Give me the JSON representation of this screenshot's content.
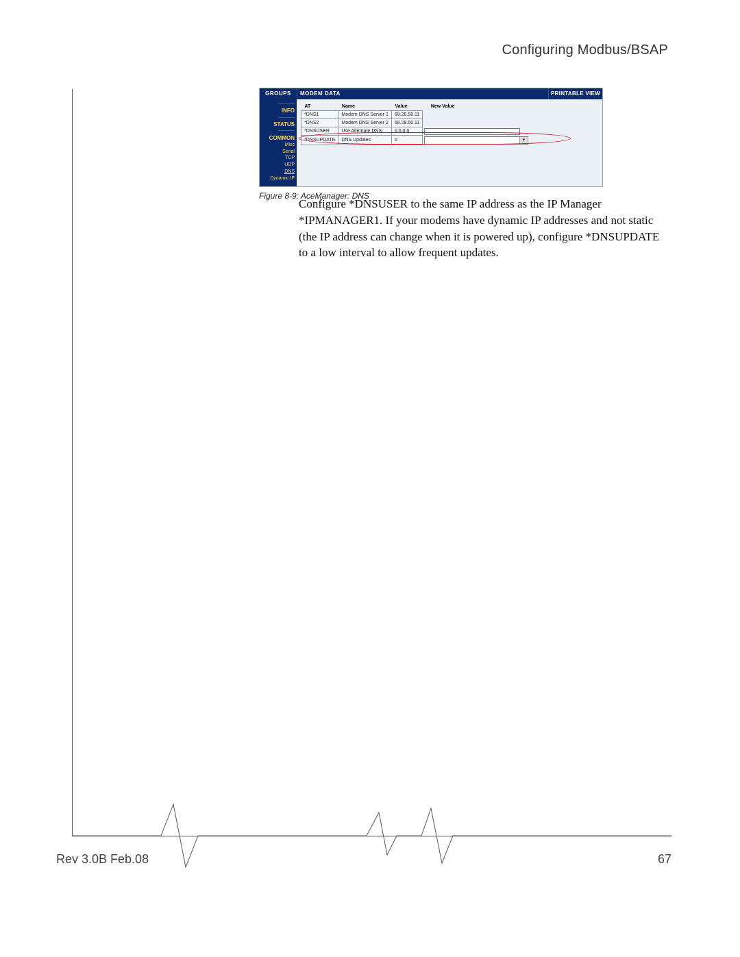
{
  "header": {
    "title": "Configuring Modbus/BSAP"
  },
  "footer": {
    "revision": "Rev 3.0B  Feb.08",
    "page": "67"
  },
  "figure": {
    "caption": "Figure 8-9:  AceManager: DNS",
    "titlebar": {
      "groups": "GROUPS",
      "modem_data": "MODEM DATA",
      "printable": "PRINTABLE VIEW"
    },
    "sidebar": {
      "sep": "----------------",
      "info": "INFO",
      "status": "STATUS",
      "common": "COMMON",
      "items": [
        "Misc",
        "Serial",
        "TCP",
        "UDP",
        "DNS",
        "Dynamic IP"
      ]
    },
    "table": {
      "headers": [
        "AT",
        "Name",
        "Value",
        "New Value"
      ],
      "rows": [
        {
          "at": "*DNS1",
          "name": "Modem DNS Server 1",
          "value": "68.28.58.11",
          "input": false
        },
        {
          "at": "*DNS2",
          "name": "Modem DNS Server 2",
          "value": "68.28.50.11",
          "input": false
        },
        {
          "at": "*DNSUSER",
          "name": "Use Alternate DNS",
          "value": "0.0.0.0",
          "input": "text"
        },
        {
          "at": "*DNSUPDATE",
          "name": "DNS Updates",
          "value": "0",
          "input": "select"
        }
      ]
    }
  },
  "body_text": "Configure *DNSUSER to the same IP address as the IP Manager *IPMANAGER1.   If your modems have dynamic IP addresses and not static (the IP address can change when it is powered up), configure *DNSUPDATE to a low interval to allow frequent updates."
}
